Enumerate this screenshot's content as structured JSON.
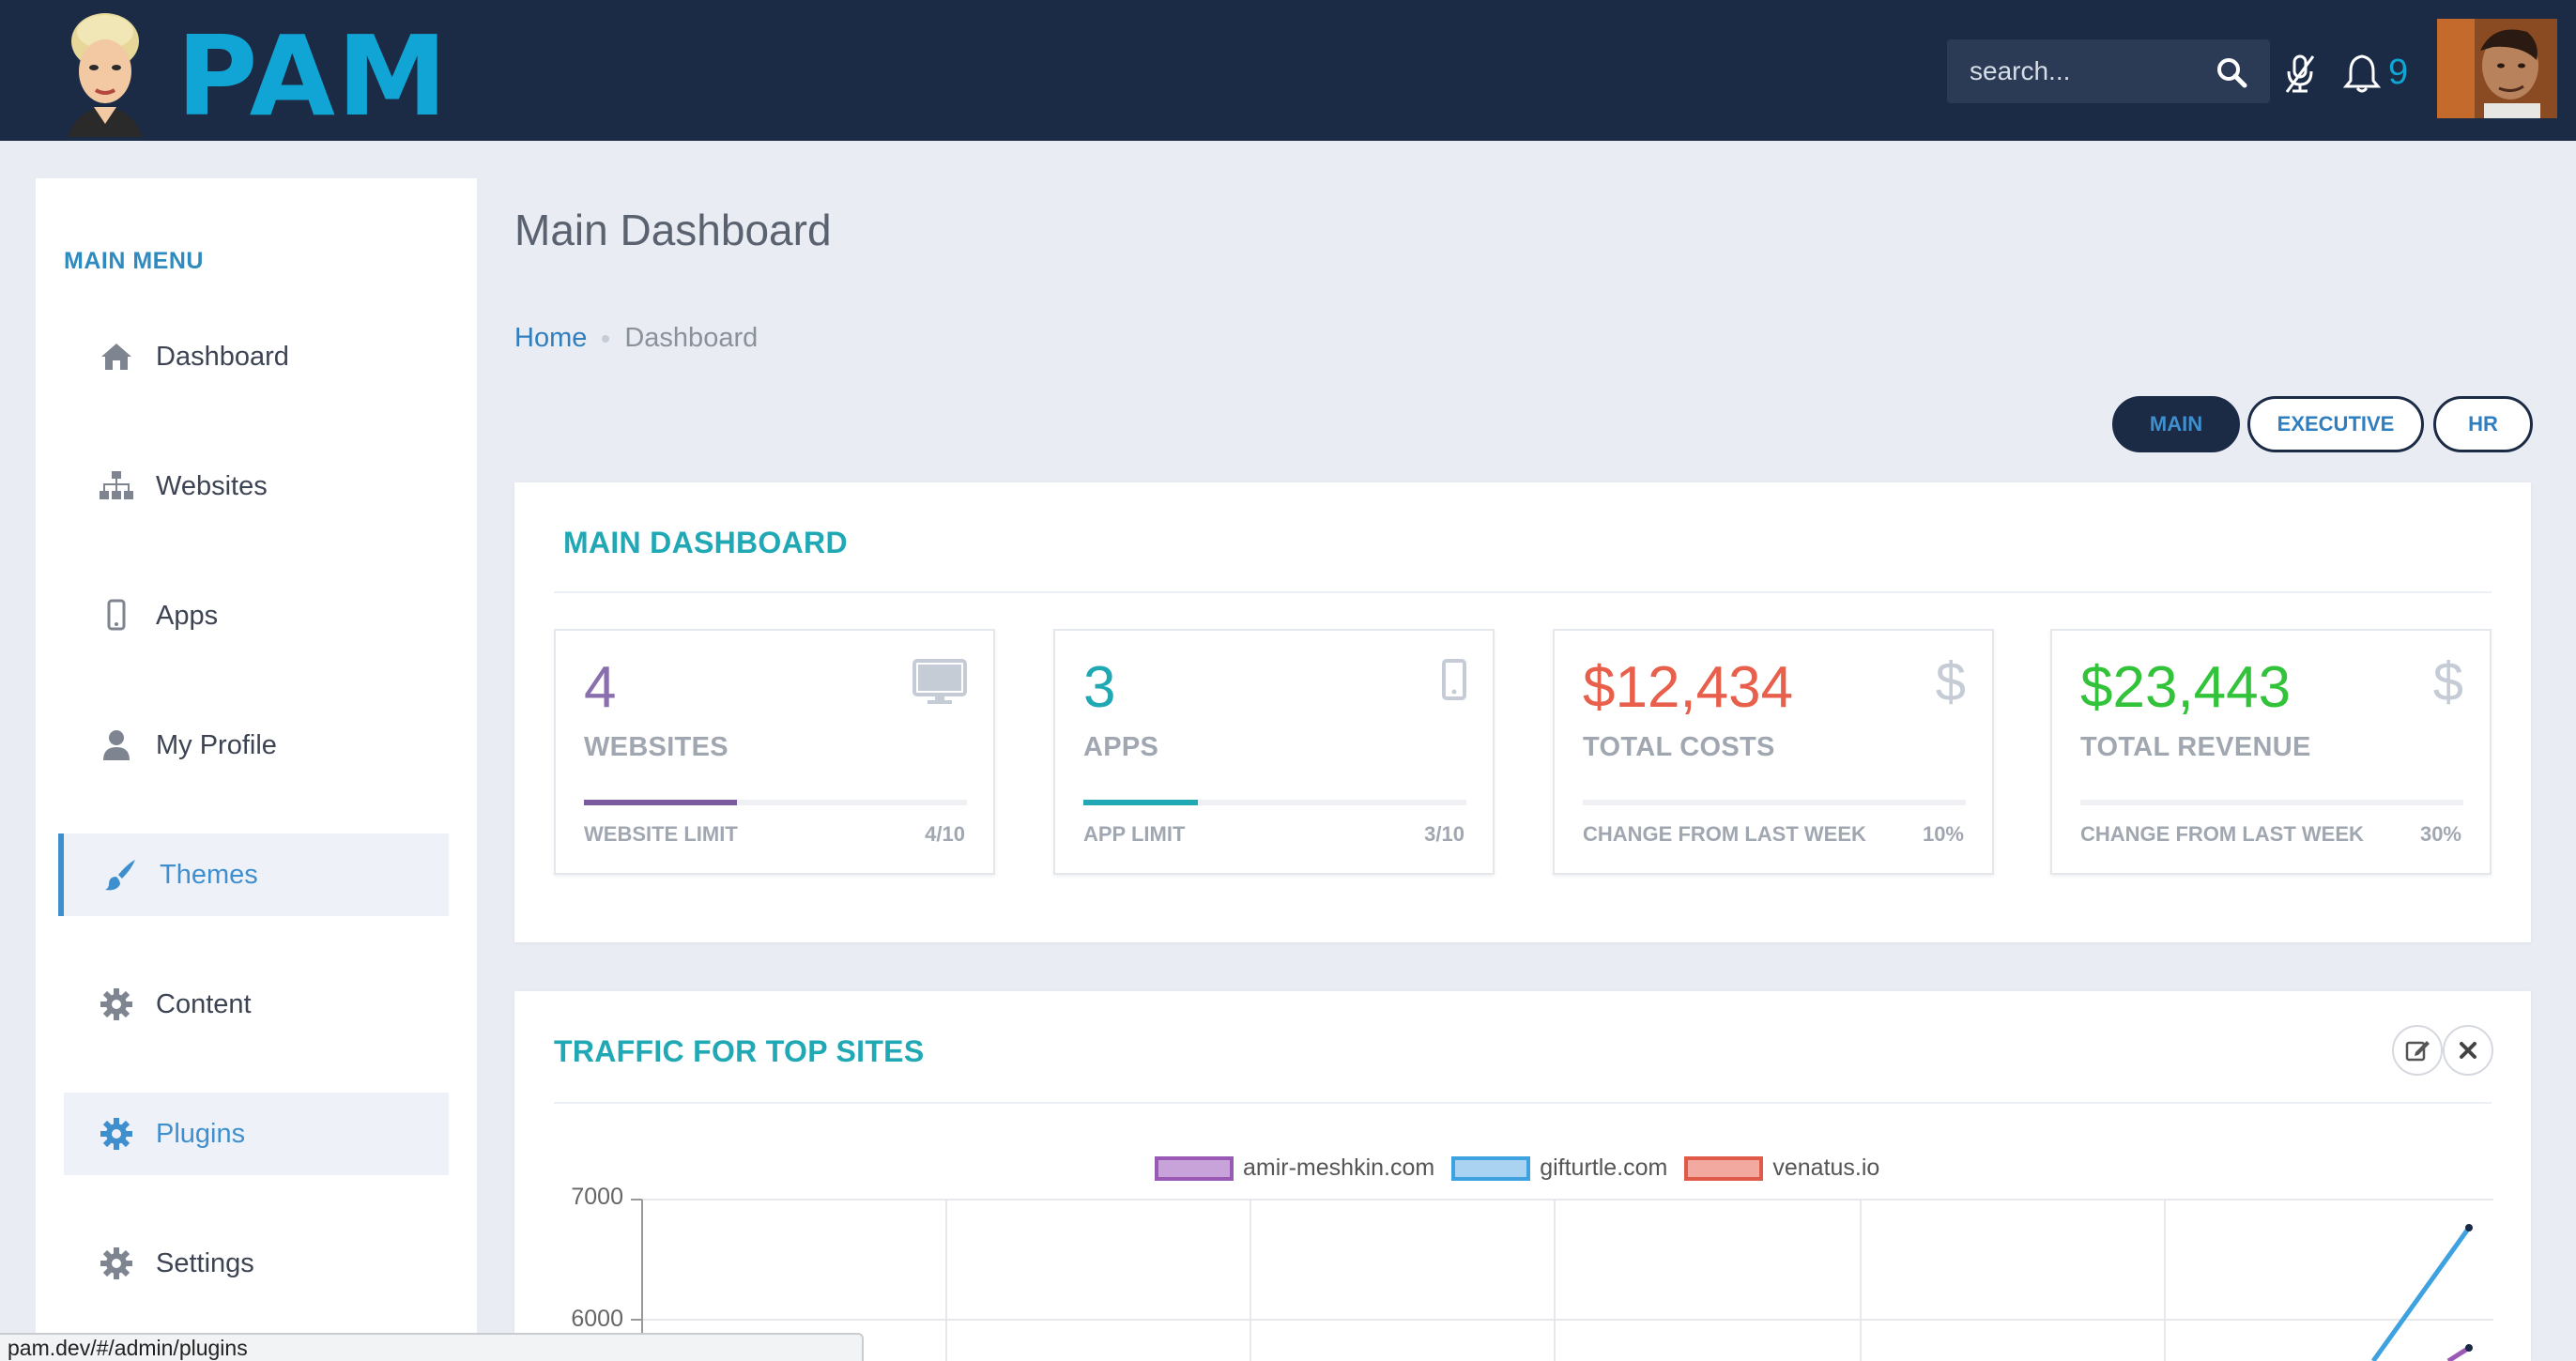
{
  "app": {
    "logo_text": "PAM",
    "search_placeholder": "search...",
    "notification_count": "9"
  },
  "sidebar": {
    "title": "MAIN MENU",
    "items": [
      {
        "label": "Dashboard",
        "icon": "home-icon"
      },
      {
        "label": "Websites",
        "icon": "sitemap-icon"
      },
      {
        "label": "Apps",
        "icon": "mobile-icon"
      },
      {
        "label": "My Profile",
        "icon": "user-icon"
      },
      {
        "label": "Themes",
        "icon": "brush-icon",
        "state": "active"
      },
      {
        "label": "Content",
        "icon": "gear-icon"
      },
      {
        "label": "Plugins",
        "icon": "gear-icon",
        "state": "hover"
      },
      {
        "label": "Settings",
        "icon": "gear-icon"
      }
    ]
  },
  "main": {
    "page_title": "Main Dashboard",
    "breadcrumb": {
      "home": "Home",
      "current": "Dashboard"
    },
    "tabs": [
      {
        "label": "MAIN",
        "selected": true
      },
      {
        "label": "EXECUTIVE",
        "selected": false
      },
      {
        "label": "HR",
        "selected": false
      }
    ],
    "dashboard_panel": {
      "title": "MAIN DASHBOARD",
      "cards": [
        {
          "value": "4",
          "label": "WEBSITES",
          "foot_left": "WEBSITE LIMIT",
          "foot_right": "4/10",
          "progress": 0.4,
          "color": "#8a6fae",
          "bar_color": "#7a5c9e",
          "icon": "monitor-icon"
        },
        {
          "value": "3",
          "label": "APPS",
          "foot_left": "APP LIMIT",
          "foot_right": "3/10",
          "progress": 0.3,
          "color": "#20a8b4",
          "bar_color": "#20a8b4",
          "icon": "mobile-icon"
        },
        {
          "value": "$12,434",
          "label": "TOTAL COSTS",
          "foot_left": "CHANGE FROM LAST WEEK",
          "foot_right": "10%",
          "progress": 0.0,
          "color": "#e8604c",
          "bar_color": "#e8604c",
          "icon": "dollar-icon"
        },
        {
          "value": "$23,443",
          "label": "TOTAL REVENUE",
          "foot_left": "CHANGE FROM LAST WEEK",
          "foot_right": "30%",
          "progress": 0.0,
          "color": "#32c33a",
          "bar_color": "#32c33a",
          "icon": "dollar-icon"
        }
      ]
    },
    "traffic_panel": {
      "title": "TRAFFIC FOR TOP SITES"
    }
  },
  "chart_data": {
    "type": "line",
    "title": "",
    "xlabel": "",
    "ylabel": "",
    "series": [
      {
        "name": "amir-meshkin.com",
        "color": "#9b59b6",
        "fill": "#c7a3d9"
      },
      {
        "name": "gifturtle.com",
        "color": "#3fa2e0",
        "fill": "#a9d3f0"
      },
      {
        "name": "venatus.io",
        "color": "#e05a4a",
        "fill": "#f1a9a0"
      }
    ],
    "y_ticks": [
      "7000",
      "6000"
    ],
    "visible_y_range": [
      6000,
      7000
    ],
    "grid": true,
    "legend_position": "top-center"
  },
  "status_bar": {
    "url": "pam.dev/#/admin/plugins"
  }
}
